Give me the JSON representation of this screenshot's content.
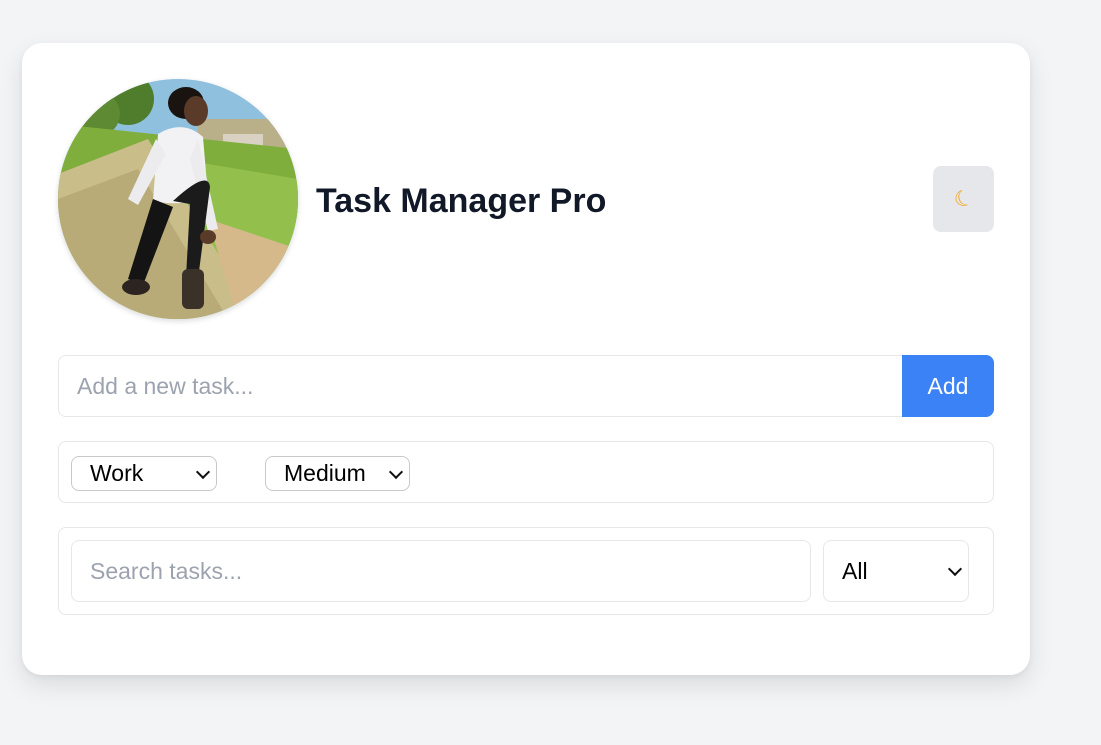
{
  "header": {
    "title": "Task Manager Pro",
    "theme_toggle_icon": "moon-icon",
    "avatar_alt": "profile-photo"
  },
  "new_task": {
    "placeholder": "Add a new task...",
    "value": "",
    "add_label": "Add"
  },
  "options": {
    "category": "Work",
    "priority": "Medium"
  },
  "search": {
    "placeholder": "Search tasks...",
    "value": "",
    "filter": "All"
  },
  "colors": {
    "accent": "#3b82f6",
    "title": "#111827",
    "page_bg": "#f3f4f6",
    "border": "#e5e7eb"
  }
}
